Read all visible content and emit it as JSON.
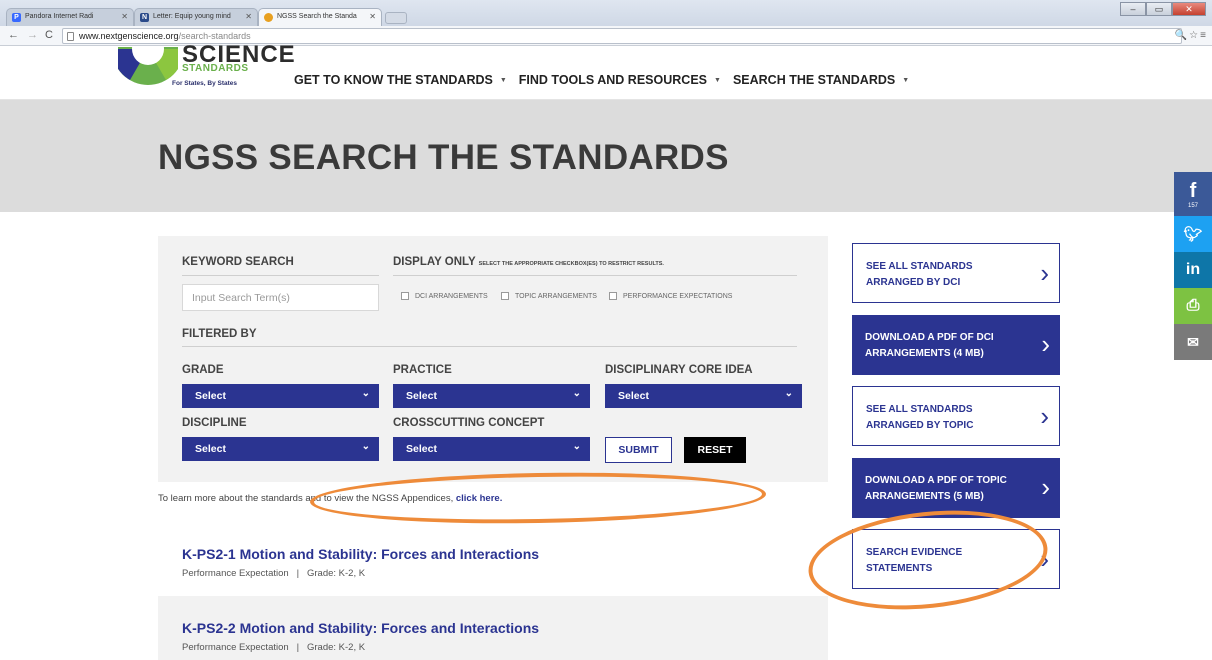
{
  "browser": {
    "tabs": [
      {
        "label": "Pandora Internet Radi",
        "icon_letter": "P",
        "icon_color": "#3668ff"
      },
      {
        "label": "Letter: Equip young mind",
        "icon_letter": "N",
        "icon_color": "#2a4a8a"
      },
      {
        "label": "NGSS Search the Standa",
        "icon_letter": "",
        "icon_color": "#e8a020"
      }
    ],
    "url_domain": "www.nextgenscience.org",
    "url_path": "/search-standards"
  },
  "header": {
    "logo_word": "SCIENCE",
    "logo_standards": "STANDARDS",
    "logo_tagline": "For States, By States",
    "nav": [
      {
        "label": "GET TO KNOW THE STANDARDS"
      },
      {
        "label": "FIND TOOLS AND RESOURCES"
      },
      {
        "label": "SEARCH THE STANDARDS"
      }
    ]
  },
  "hero": {
    "title": "NGSS SEARCH THE STANDARDS"
  },
  "social": {
    "facebook_count": "157"
  },
  "search": {
    "keyword_label": "KEYWORD SEARCH",
    "keyword_placeholder": "Input Search Term(s)",
    "display_only_label": "DISPLAY ONLY",
    "display_only_hint": "SELECT THE APPROPRIATE CHECKBOX(ES) TO RESTRICT RESULTS.",
    "checkboxes": [
      {
        "label": "DCI ARRANGEMENTS"
      },
      {
        "label": "TOPIC ARRANGEMENTS"
      },
      {
        "label": "PERFORMANCE EXPECTATIONS"
      }
    ],
    "filtered_by_label": "FILTERED BY",
    "filters": {
      "grade": {
        "label": "GRADE",
        "value": "Select"
      },
      "practice": {
        "label": "PRACTICE",
        "value": "Select"
      },
      "dci": {
        "label": "DISCIPLINARY CORE IDEA",
        "value": "Select"
      },
      "discipline": {
        "label": "DISCIPLINE",
        "value": "Select"
      },
      "crosscutting": {
        "label": "CROSSCUTTING CONCEPT",
        "value": "Select"
      }
    },
    "submit_label": "SUBMIT",
    "reset_label": "RESET"
  },
  "learn_more": {
    "text": "To learn more about the standards and to view the NGSS Appendices,",
    "link": "click here."
  },
  "results": [
    {
      "title": "K-PS2-1 Motion and Stability: Forces and Interactions",
      "type": "Performance Expectation",
      "grade": "Grade: K-2,  K"
    },
    {
      "title": "K-PS2-2 Motion and Stability: Forces and Interactions",
      "type": "Performance Expectation",
      "grade": "Grade: K-2,  K"
    }
  ],
  "side_buttons": [
    {
      "label": "SEE ALL STANDARDS ARRANGED BY DCI"
    },
    {
      "label": "DOWNLOAD A PDF OF DCI ARRANGEMENTS (4 MB)"
    },
    {
      "label": "SEE ALL STANDARDS ARRANGED BY TOPIC"
    },
    {
      "label": "DOWNLOAD A PDF OF TOPIC ARRANGEMENTS (5 MB)"
    },
    {
      "label": "SEARCH EVIDENCE STATEMENTS"
    }
  ],
  "colors": {
    "brand_blue": "#2b3491",
    "annotation_orange": "#ee8b3a",
    "hero_gray": "#dcdcdc"
  }
}
